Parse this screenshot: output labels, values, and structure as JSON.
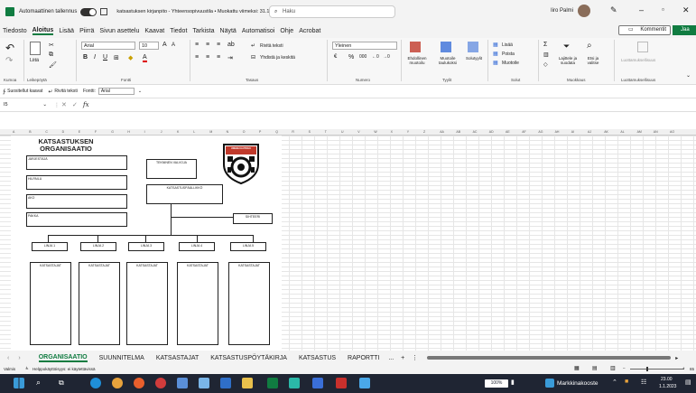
{
  "titlebar": {
    "autosave_label": "Automaattinen tallennus",
    "doc_title": "katsastuksen kirjanpito  -  Yhteensopivuustila  •  Muokattu viimeksi: 31.10.2002",
    "search_placeholder": "Haku",
    "user_name": "Iiro Palmi"
  },
  "menu": {
    "items": [
      "Tiedosto",
      "Aloitus",
      "Lisää",
      "Piirrä",
      "Sivun asettelu",
      "Kaavat",
      "Tiedot",
      "Tarkista",
      "Näytä",
      "Automatisoi",
      "Ohje",
      "Acrobat"
    ],
    "comments_label": "Kommentit",
    "share_label": "Jaa"
  },
  "ribbon": {
    "paste_label": "Liitä",
    "font_name": "Arial",
    "font_size": "10",
    "wrap_text": "Rivitä teksti",
    "merge_center": "Yhdistä ja keskitä",
    "number_format": "Yleinen",
    "cond_format": "Ehdollinen muotoilu",
    "format_table": "Muotoile taulukoksi",
    "cell_styles": "Solutyylit",
    "insert": "Lisää",
    "delete": "Poista",
    "format": "Muotoile",
    "sort_filter": "Lajittele ja suodata",
    "find_select": "Etsi ja valitse",
    "sensitivity": "Luottamuksellisuus",
    "groups": [
      "Kumoa",
      "Leikepöytä",
      "Fontti",
      "Tasaus",
      "Numero",
      "Tyylit",
      "Solut",
      "Muokkaus",
      "Luottamuksellisuus"
    ]
  },
  "quickaccess": {
    "suggested": "Suositellut kaavat",
    "wrap": "Rivitä teksti",
    "font_label": "Fontti:",
    "font_value": "Arial"
  },
  "formula": {
    "cell_ref": "I5",
    "fx": "fx"
  },
  "columns": [
    "A",
    "B",
    "C",
    "D",
    "E",
    "F",
    "G",
    "H",
    "I",
    "J",
    "K",
    "L",
    "M",
    "N",
    "O",
    "P",
    "Q",
    "R",
    "S",
    "T",
    "U",
    "V",
    "W",
    "X",
    "Y",
    "Z",
    "AA",
    "AB",
    "AC",
    "AD",
    "AE",
    "AF",
    "AG",
    "AH",
    "AI",
    "AJ",
    "AK",
    "AL",
    "AM",
    "AN",
    "AO"
  ],
  "org": {
    "title_line1": "KATSASTUKSEN",
    "title_line2": "ORGANISAATIO",
    "boxes": {
      "jarjestaja": "JÄRJESTÄJÄ",
      "hilpaiu": "HILPAILU",
      "ako": "AKO",
      "pakka": "PAKKA",
      "tekninen": "TEKNINEN VALVOJA",
      "katsastus_pall": "KATSASTUSPÄÄLLIKKÖ",
      "sihteeri": "SIHTEERI"
    },
    "linjat": [
      "LINJA 1",
      "LINJA 2",
      "LINJA 3",
      "LINJA 4",
      "LINJA 5"
    ],
    "katsastajat": "KATSASTAJAT",
    "logo_text": "URHEILUAUTOILU"
  },
  "sheets": {
    "tabs": [
      "ORGANISAATIO",
      "SUUNNITELMA",
      "KATSASTAJAT",
      "KATSASTUSPÖYTÄKIRJA",
      "KATSASTUS",
      "RAPORTTI"
    ],
    "more": "...",
    "add": "+"
  },
  "status": {
    "ready": "Valmis",
    "accessibility": "Helppokäyttöisyys: ei käytettävissä",
    "zoom": "65"
  },
  "taskbar": {
    "battery": "100%",
    "app_label": "Markkinakooste",
    "time": "23.00",
    "date": "1.1.2023"
  },
  "colors": {
    "excel_green": "#107c41",
    "taskbar": "#1f2533"
  }
}
